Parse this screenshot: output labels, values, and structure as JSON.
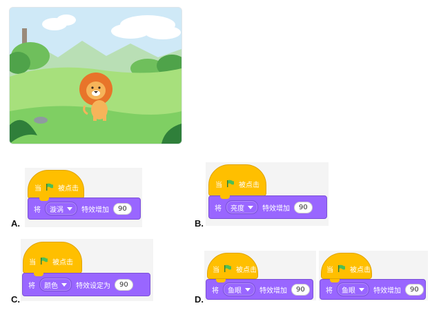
{
  "options": [
    {
      "label": "A.",
      "hat_text": "当",
      "hat_text2": "被点击",
      "cmd_prefix": "将",
      "effect": "漩涡",
      "cmd_middle": "特效增加",
      "value": "90"
    },
    {
      "label": "B.",
      "hat_text": "当",
      "hat_text2": "被点击",
      "cmd_prefix": "将",
      "effect": "亮度",
      "cmd_middle": "特效增加",
      "value": "90"
    },
    {
      "label": "C.",
      "hat_text": "当",
      "hat_text2": "被点击",
      "cmd_prefix": "将",
      "effect": "颜色",
      "cmd_middle": "特效设定为",
      "value": "90"
    },
    {
      "label": "D.",
      "hat_text": "当",
      "hat_text2": "被点击",
      "cmd_prefix": "将",
      "effect": "鱼眼",
      "cmd_middle": "特效增加",
      "value": "90"
    },
    {
      "label": "",
      "hat_text": "当",
      "hat_text2": "被点击",
      "cmd_prefix": "将",
      "effect": "鱼眼",
      "cmd_middle": "特效增加",
      "value": "90"
    }
  ],
  "icons": {
    "green_flag": "green-flag-icon",
    "dropdown": "caret-down-icon"
  },
  "colors": {
    "event_yellow": "#ffbf00",
    "looks_purple": "#9966ff",
    "flag_green": "#4cbf56",
    "grass": "#a7e07c",
    "sky": "#cfe9f7"
  }
}
